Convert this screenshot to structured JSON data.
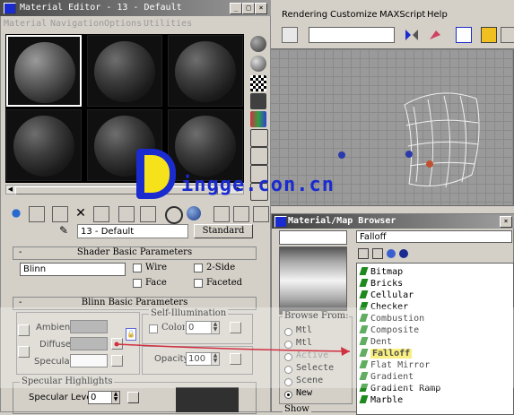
{
  "colors": {
    "accent_red": "#d03040",
    "selection_yellow": "#f6e84a",
    "watermark_blue": "#1a2bd0",
    "watermark_yellow": "#f5e21a"
  },
  "max_menu": [
    "Rendering",
    "Customize",
    "MAXScript",
    "Help"
  ],
  "material_editor": {
    "title": "Material Editor - 13 - Default",
    "menu": [
      "Material",
      "Navigation",
      "Options",
      "Utilities"
    ],
    "material_name": "13 - Default",
    "material_type": "Standard",
    "shader_rollout": {
      "title": "Shader Basic Parameters",
      "shader": "Blinn",
      "options": [
        "Wire",
        "2-Sided",
        "Face Map",
        "Faceted"
      ]
    },
    "blinn_rollout": {
      "title": "Blinn Basic Parameters",
      "ambient_label": "Ambient:",
      "diffuse_label": "Diffuse:",
      "specular_label": "Specular:",
      "self_illum_label": "Self-Illumination",
      "color_label": "Color",
      "self_illum_value": "0",
      "opacity_label": "Opacity:",
      "opacity_value": "100"
    },
    "specular_rollout": {
      "title": "Specular Highlights",
      "level_label": "Specular Level:",
      "level_value": "0"
    }
  },
  "map_browser": {
    "title": "Material/Map Browser",
    "filter": "Falloff",
    "browse_from_label": "Browse From:",
    "browse_options": [
      {
        "label": "Mtl Library",
        "selected": false
      },
      {
        "label": "Mtl Editor",
        "selected": false
      },
      {
        "label": "Active Slot",
        "selected": false,
        "disabled": true
      },
      {
        "label": "Selected",
        "selected": false
      },
      {
        "label": "Scene",
        "selected": false
      },
      {
        "label": "New",
        "selected": true
      }
    ],
    "show_label": "Show",
    "items": [
      "Bitmap",
      "Bricks",
      "Cellular",
      "Checker",
      "Combustion",
      "Composite",
      "Dent",
      "Falloff",
      "Flat Mirror",
      "Gradient",
      "Gradient Ramp",
      "Marble"
    ],
    "selected_item": "Falloff"
  },
  "watermark": "ingge.con.cn"
}
